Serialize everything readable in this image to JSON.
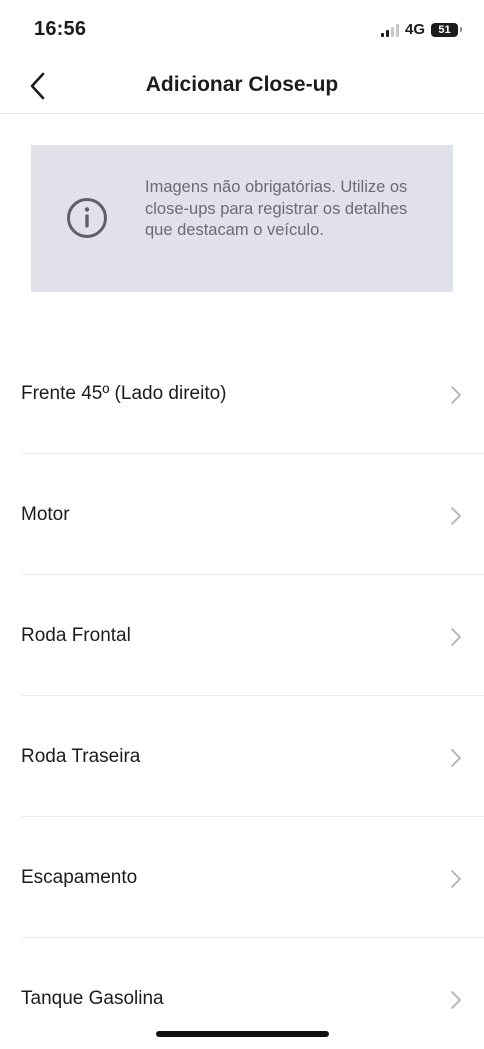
{
  "status_bar": {
    "time": "16:56",
    "network": "4G",
    "battery_level": "51"
  },
  "nav": {
    "title": "Adicionar Close-up",
    "back_icon": "chevron-left-icon"
  },
  "info": {
    "icon": "info-circle-icon",
    "text": "Imagens não obrigatórias. Utilize os close-ups para registrar os detalhes que destacam o veículo."
  },
  "list": {
    "items": [
      {
        "label": "Frente 45º (Lado direito)"
      },
      {
        "label": "Motor"
      },
      {
        "label": "Roda Frontal"
      },
      {
        "label": "Roda Traseira"
      },
      {
        "label": "Escapamento"
      },
      {
        "label": "Tanque Gasolina"
      }
    ],
    "chevron_icon": "chevron-right-icon"
  },
  "colors": {
    "info_background": "#e1e1ea",
    "text_primary": "#1c1c1e",
    "text_secondary": "#6b6b75",
    "chevron": "#b0b0b8"
  }
}
